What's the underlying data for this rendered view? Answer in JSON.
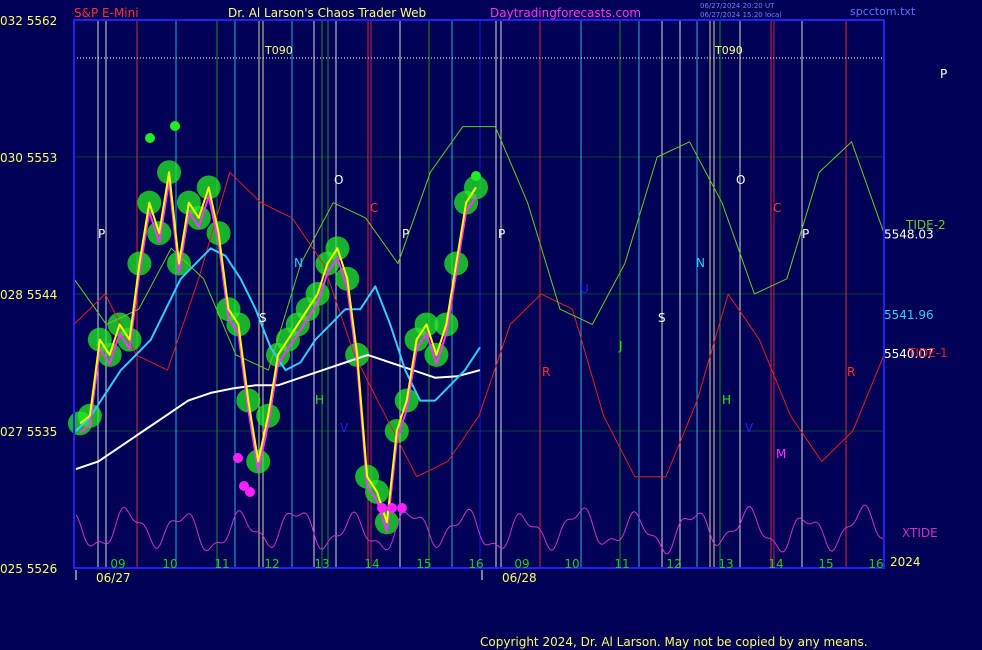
{
  "header": {
    "instrument": "S&P E-Mini",
    "title": "Dr. Al Larson's Chaos Trader Web",
    "site": "Daytradingforecasts.com",
    "timestamp_1": "06/27/2024 20:20 UT",
    "timestamp_2": "06/27/2024 15:20 local",
    "file": "spcctom.txt"
  },
  "footer": {
    "copyright": "Copyright 2024, Dr. Al Larson. May not be copied by any means."
  },
  "colors": {
    "background": "#000055",
    "frame": "#2020ff",
    "price": "#ffff00",
    "price_alt": "#ff33ff",
    "ema_fast": "#33ccff",
    "ema_slow": "#ffffff",
    "tide1": "#dd2222",
    "tide2": "#66cc22",
    "xtide": "#cc33cc",
    "glow": "#22ee22"
  },
  "chart_data": {
    "type": "line",
    "y_axis": {
      "ticks": [
        {
          "value": 5562,
          "code": "032"
        },
        {
          "value": 5553,
          "code": "030"
        },
        {
          "value": 5544,
          "code": "028"
        },
        {
          "value": 5535,
          "code": "027"
        },
        {
          "value": 5526,
          "code": "025"
        }
      ],
      "ylim": [
        5526,
        5562
      ]
    },
    "x_axis": {
      "hour_labels": [
        "09",
        "10",
        "11",
        "12",
        "13",
        "14",
        "15",
        "16",
        "09",
        "10",
        "11",
        "12",
        "13",
        "14",
        "15",
        "16"
      ],
      "date_labels": [
        "06/27",
        "06/28"
      ],
      "year_label": "2024"
    },
    "series": [
      {
        "name": "price",
        "values": [
          5535.5,
          5536,
          5541,
          5540,
          5542,
          5541,
          5546,
          5550,
          5548,
          5552,
          5546,
          5550,
          5549,
          5551,
          5548,
          5543,
          5542,
          5537,
          5533,
          5536,
          5540,
          5541,
          5542,
          5543,
          5544,
          5546,
          5547,
          5545,
          5540,
          5532,
          5531,
          5529,
          5535,
          5537,
          5541,
          5542,
          5540,
          5542,
          5546,
          5550,
          5551
        ]
      },
      {
        "name": "ema_fast",
        "values": [
          5535,
          5536,
          5537.5,
          5539,
          5540,
          5541,
          5543,
          5545,
          5546,
          5547,
          5546.5,
          5545,
          5543,
          5540.5,
          5539,
          5539.5,
          5541,
          5542,
          5543,
          5543,
          5544.5,
          5542,
          5539,
          5537,
          5537,
          5538,
          5539,
          5540.5
        ]
      },
      {
        "name": "ema_slow",
        "values": [
          5532.5,
          5533,
          5534,
          5535,
          5536,
          5537,
          5537.5,
          5537.8,
          5538,
          5538,
          5538.5,
          5539,
          5539.5,
          5540,
          5539.5,
          5539,
          5538.5,
          5538.6,
          5539
        ]
      },
      {
        "name": "TIDE-1",
        "values": [
          5542,
          5544,
          5540,
          5539,
          5545,
          5552,
          5550,
          5549,
          5546,
          5540,
          5536,
          5532,
          5533,
          5536,
          5542,
          5544,
          5543,
          5536,
          5532,
          5532,
          5537,
          5544,
          5541,
          5536,
          5533,
          5535,
          5540
        ]
      },
      {
        "name": "TIDE-2",
        "values": [
          5545,
          5542,
          5543,
          5547,
          5545,
          5540,
          5539,
          5546,
          5550,
          5549,
          5546,
          5552,
          5555,
          5555,
          5550,
          5543,
          5542,
          5546,
          5553,
          5554,
          5550,
          5544,
          5545,
          5552,
          5554,
          5548
        ]
      },
      {
        "name": "XTIDE"
      }
    ],
    "price_labels": [
      {
        "text": "5548.03",
        "value": 5548.03,
        "color": "#ffffff"
      },
      {
        "text": "5541.96",
        "value": 5541.96,
        "color": "#33ccff"
      },
      {
        "text": "5540.07",
        "value": 5540.07,
        "color": "#ffffff"
      }
    ],
    "series_labels": [
      "TIDE-2",
      "TIDE-1",
      "XTIDE"
    ],
    "level_lines": [
      {
        "label": "T090",
        "value": 5559.5
      },
      {
        "label": "T090",
        "value": 5559.5
      }
    ],
    "planet_letters": [
      "P",
      "O",
      "N",
      "S",
      "H",
      "V",
      "C",
      "P",
      "P",
      "U",
      "R",
      "J",
      "S",
      "N",
      "H",
      "O",
      "C",
      "V",
      "M",
      "P",
      "R",
      "P"
    ]
  }
}
